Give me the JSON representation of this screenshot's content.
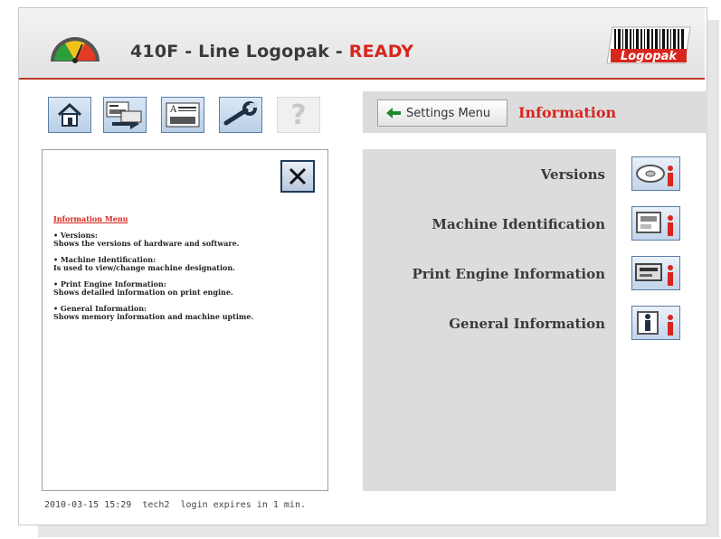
{
  "header": {
    "machine": "410F - Line Logopak - ",
    "state": "READY",
    "logo_text": "Logopak"
  },
  "toolbar": {
    "buttons": [
      {
        "name": "home-icon"
      },
      {
        "name": "label-transfer-icon"
      },
      {
        "name": "label-editor-icon"
      },
      {
        "name": "wrench-icon"
      },
      {
        "name": "help-icon"
      }
    ],
    "help_glyph": "?"
  },
  "nav": {
    "back_label": "Settings Menu",
    "breadcrumb": "Information"
  },
  "help_panel": {
    "title": "Information Menu",
    "items": [
      {
        "head": "• Versions:",
        "body": "Shows the versions of hardware and software."
      },
      {
        "head": "• Machine Identification:",
        "body": "Is used to view/change machine designation."
      },
      {
        "head": "• Print Engine Information:",
        "body": "Shows detailed information on print engine."
      },
      {
        "head": "• General Information:",
        "body": "Shows memory information and machine uptime."
      }
    ]
  },
  "info_menu": {
    "items": [
      {
        "label": "Versions",
        "icon": "versions-info-icon"
      },
      {
        "label": "Machine Identification",
        "icon": "machine-identification-info-icon"
      },
      {
        "label": "Print Engine Information",
        "icon": "print-engine-info-icon"
      },
      {
        "label": "General Information",
        "icon": "general-info-icon"
      }
    ]
  },
  "status_bar": {
    "text": "2010-03-15 15:29  tech2  login expires in 1 min."
  },
  "colors": {
    "accent": "#d7261e",
    "panel": "#dcdcdc",
    "button_border": "#5b7ea6"
  }
}
